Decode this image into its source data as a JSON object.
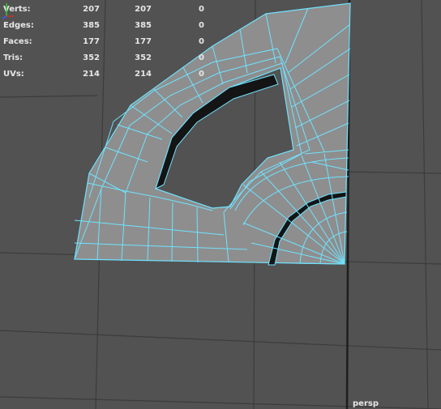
{
  "viewport": {
    "camera": "persp",
    "colors": {
      "background": "#525252",
      "grid": "#3c3c3c",
      "grid_axis": "#1e1e1e",
      "mesh_fill": "#8e8e8e",
      "wireframe": "#6fe3ff",
      "hole": "#141414"
    }
  },
  "hud": {
    "stats": [
      {
        "label": "Verts:",
        "v1": "207",
        "v2": "207",
        "v3": "0"
      },
      {
        "label": "Edges:",
        "v1": "385",
        "v2": "385",
        "v3": "0"
      },
      {
        "label": "Faces:",
        "v1": "177",
        "v2": "177",
        "v3": "0"
      },
      {
        "label": "Tris:",
        "v1": "352",
        "v2": "352",
        "v3": "0"
      },
      {
        "label": "UVs:",
        "v1": "214",
        "v2": "214",
        "v3": "0"
      }
    ]
  },
  "axis_gizmo": {
    "icon": "xyz-axis-icon",
    "x_color": "#d03030",
    "y_color": "#30d030"
  }
}
